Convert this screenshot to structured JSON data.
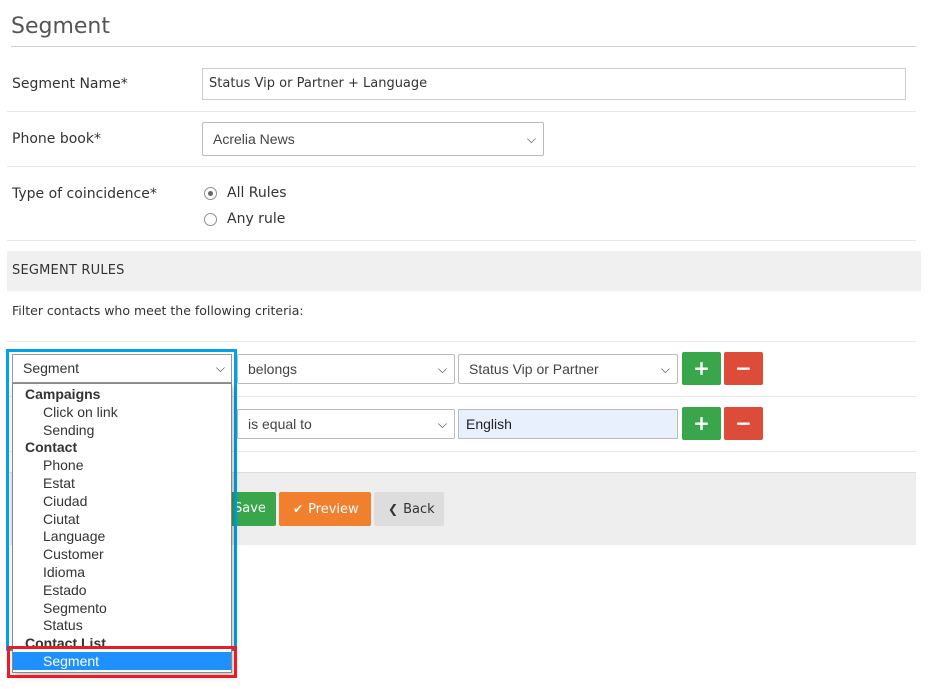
{
  "page": {
    "title": "Segment"
  },
  "form": {
    "segment_name_label": "Segment Name*",
    "segment_name_value": "Status Vip or Partner + Language",
    "phone_book_label": "Phone book*",
    "phone_book_value": "Acrelia News",
    "coincidence_label": "Type of coincidence*",
    "coincidence_options": [
      "All Rules",
      "Any rule"
    ],
    "coincidence_selected": "All Rules"
  },
  "rules": {
    "header": "SEGMENT RULES",
    "filter_text": "Filter contacts who meet the following criteria:",
    "rows": [
      {
        "field": "Segment",
        "operator": "belongs",
        "value": "Status Vip or Partner"
      },
      {
        "field": "",
        "operator": "is equal to",
        "value": "English"
      }
    ],
    "add_label": "+",
    "remove_label": "−"
  },
  "dropdown": {
    "groups": [
      {
        "label": "Campaigns",
        "options": [
          "Click on link",
          "Sending"
        ]
      },
      {
        "label": "Contact",
        "options": [
          "Phone",
          "Estat",
          "Ciudad",
          "Ciutat",
          "Language",
          "Customer",
          "Idioma",
          "Estado",
          "Segmento",
          "Status"
        ]
      },
      {
        "label": "Contact List",
        "options": [
          "Segment"
        ]
      }
    ],
    "highlighted": "Segment"
  },
  "actions": {
    "save_label": "Save",
    "preview_label": "Preview",
    "back_label": "Back"
  },
  "colors": {
    "green": "#3aa64c",
    "red": "#dd4b39",
    "orange": "#f07f2e",
    "highlight_blue": "#1e90ff",
    "frame_blue": "#00a2e8",
    "frame_red": "#ed1c24"
  }
}
